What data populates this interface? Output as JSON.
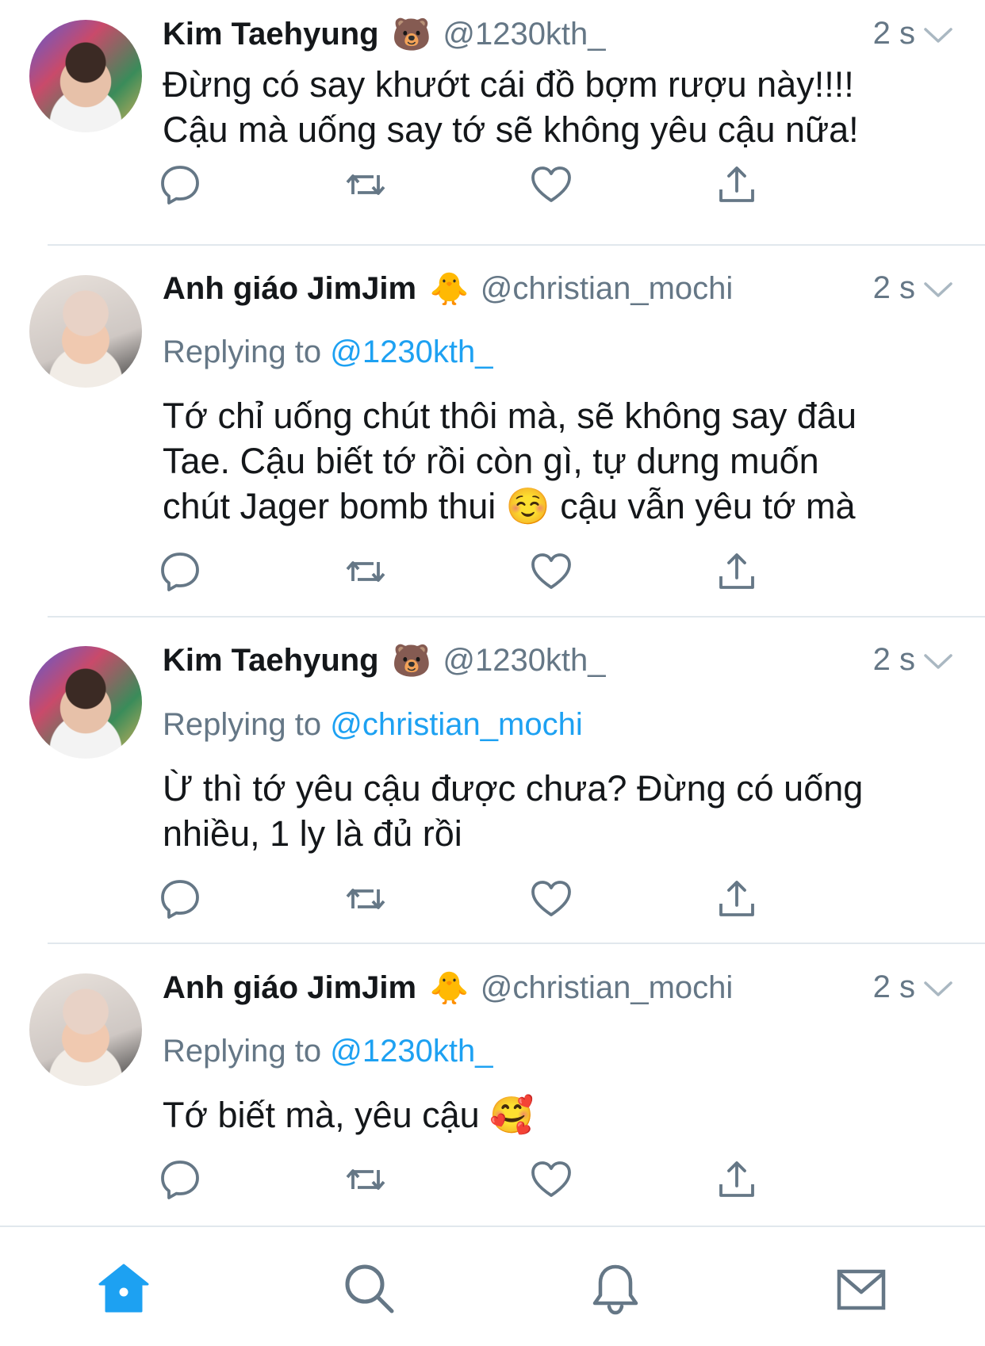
{
  "tweets": [
    {
      "name": "Kim Taehyung",
      "emoji": "🐻",
      "handle": "@1230kth_",
      "time": "2 s",
      "replying_prefix": "",
      "replying_handle": "",
      "text_lines": [
        "Đừng có say khướt cái đồ bợm rượu này!!!!",
        "Cậu mà uống say tớ sẽ không yêu cậu nữa!"
      ]
    },
    {
      "name": "Anh giáo JimJim",
      "emoji": "🐥",
      "handle": "@christian_mochi",
      "time": "2 s",
      "replying_prefix": "Replying to",
      "replying_handle": "@1230kth_",
      "text_lines": [
        "Tớ chỉ uống chút thôi mà, sẽ không say đâu",
        "Tae. Cậu biết tớ rồi còn gì, tự dưng muốn",
        "chút Jager bomb thui ☺️  cậu vẫn yêu tớ mà"
      ]
    },
    {
      "name": "Kim Taehyung",
      "emoji": "🐻",
      "handle": "@1230kth_",
      "time": "2 s",
      "replying_prefix": "Replying to",
      "replying_handle": "@christian_mochi",
      "text_lines": [
        "Ừ thì tớ yêu cậu được chưa? Đừng có uống",
        "nhiều, 1 ly là đủ rồi"
      ]
    },
    {
      "name": "Anh giáo JimJim",
      "emoji": "🐥",
      "handle": "@christian_mochi",
      "time": "2 s",
      "replying_prefix": "Replying to",
      "replying_handle": "@1230kth_",
      "text_lines": [
        "Tớ biết mà, yêu cậu 🥰"
      ]
    }
  ],
  "action_icons": [
    "reply-icon",
    "retweet-icon",
    "like-icon",
    "share-icon"
  ],
  "tab_icons": [
    "home-icon",
    "search-icon",
    "notifications-icon",
    "messages-icon"
  ],
  "colors": {
    "accent": "#1da1f2",
    "secondary_text": "#657786",
    "primary_text": "#14171a",
    "divider": "#e1e8ed",
    "icon_gray": "#657786"
  }
}
